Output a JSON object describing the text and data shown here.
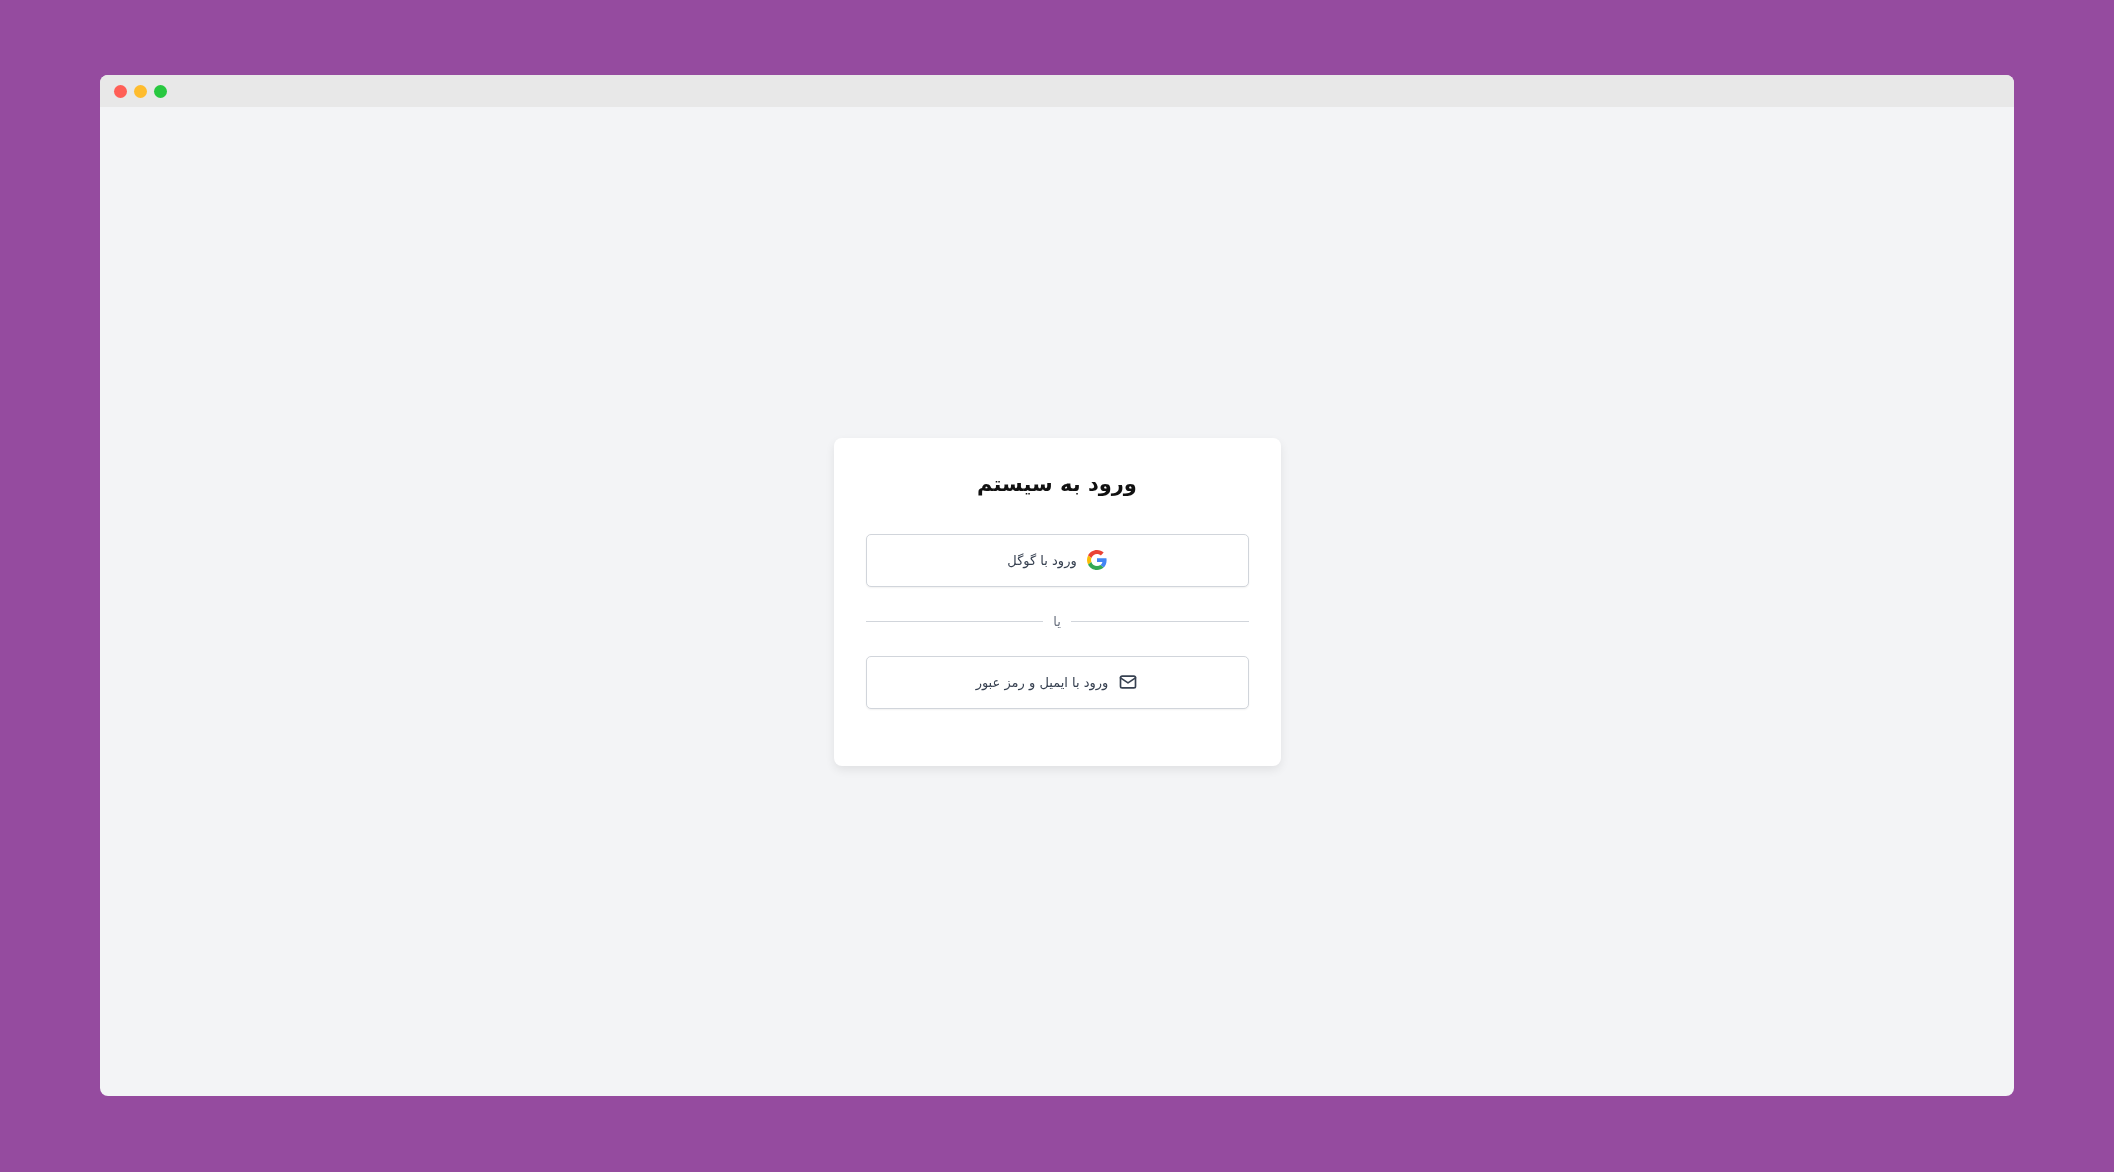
{
  "window": {
    "controls": [
      {
        "color": "#ff5f57"
      },
      {
        "color": "#febc2e"
      },
      {
        "color": "#28c840"
      }
    ]
  },
  "login_card": {
    "title": "ورود به سیستم",
    "buttons": [
      {
        "kind": "google",
        "label": "ورود با گوگل"
      },
      {
        "kind": "divider",
        "label": "یا"
      },
      {
        "kind": "email",
        "label": "ورود با ایمیل و رمز عبور"
      }
    ]
  }
}
